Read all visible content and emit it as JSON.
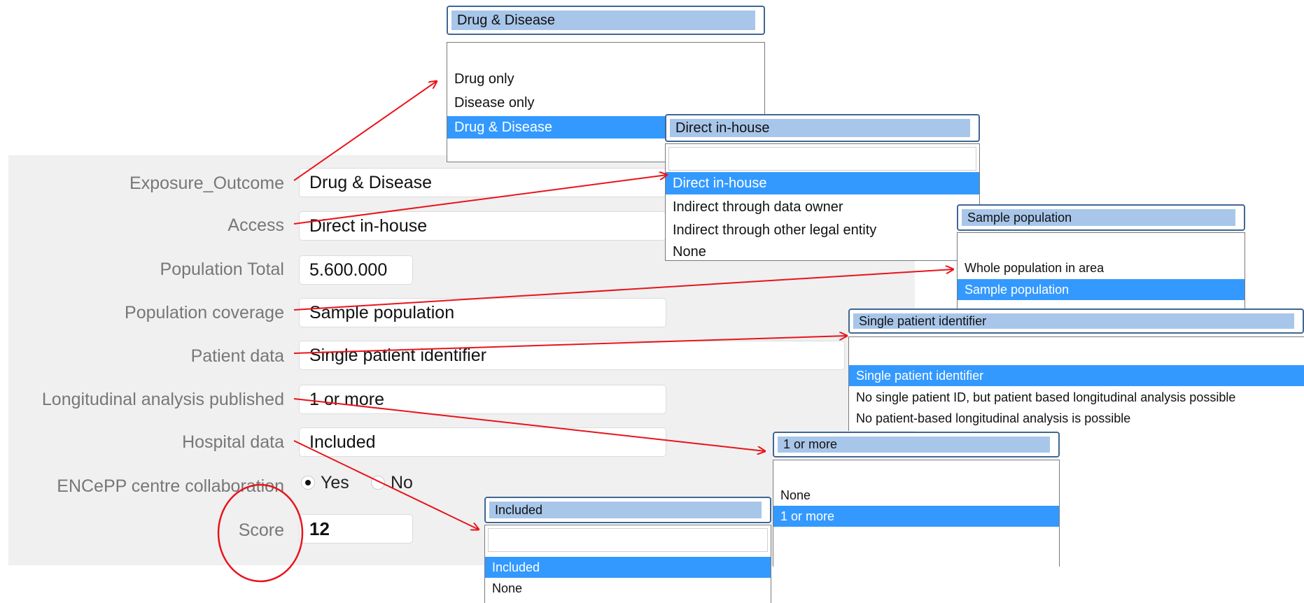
{
  "form": {
    "labels": {
      "exposure": "Exposure_Outcome",
      "access": "Access",
      "population_total": "Population Total",
      "population_coverage": "Population coverage",
      "patient_data": "Patient data",
      "longitudinal": "Longitudinal analysis published",
      "hospital": "Hospital data",
      "encepp": "ENCePP centre collaboration",
      "score": "Score"
    },
    "values": {
      "exposure": "Drug & Disease",
      "access": "Direct in-house",
      "population_total": "5.600.000",
      "population_coverage": "Sample population",
      "patient_data": "Single patient identifier",
      "longitudinal": "1 or more",
      "hospital": "Included",
      "score": "12"
    },
    "encepp_options": {
      "yes": "Yes",
      "no": "No",
      "selected": "Yes"
    }
  },
  "dropdowns": {
    "exposure": {
      "header": "Drug & Disease",
      "options": [
        "Drug only",
        "Disease only",
        "Drug & Disease"
      ],
      "selected": "Drug & Disease"
    },
    "access": {
      "header": "Direct in-house",
      "options": [
        "Direct in-house",
        "Indirect through data owner",
        "Indirect through other legal entity",
        "None"
      ],
      "selected": "Direct in-house"
    },
    "population_coverage": {
      "header": "Sample population",
      "options": [
        "Whole population in area",
        "Sample population"
      ],
      "selected": "Sample population"
    },
    "patient_data": {
      "header": "Single patient identifier",
      "options": [
        "Single patient identifier",
        "No single patient ID, but patient based longitudinal analysis possible",
        "No patient-based longitudinal analysis is possible"
      ],
      "selected": "Single patient identifier"
    },
    "longitudinal": {
      "header": "1 or more",
      "options": [
        "None",
        "1 or more"
      ],
      "selected": "1 or more"
    },
    "hospital": {
      "header": "Included",
      "options": [
        "Included",
        "None"
      ],
      "selected": "Included"
    }
  },
  "colors": {
    "panel_bg": "#f0f0f0",
    "label_text": "#777777",
    "selection": "#3399ff",
    "header_fill": "#a8c6ea",
    "header_border": "#3f6794",
    "annotation_red": "#e8141b"
  },
  "annotations": {
    "arrows_color": "#e8141b",
    "score_highlight": "circle"
  }
}
